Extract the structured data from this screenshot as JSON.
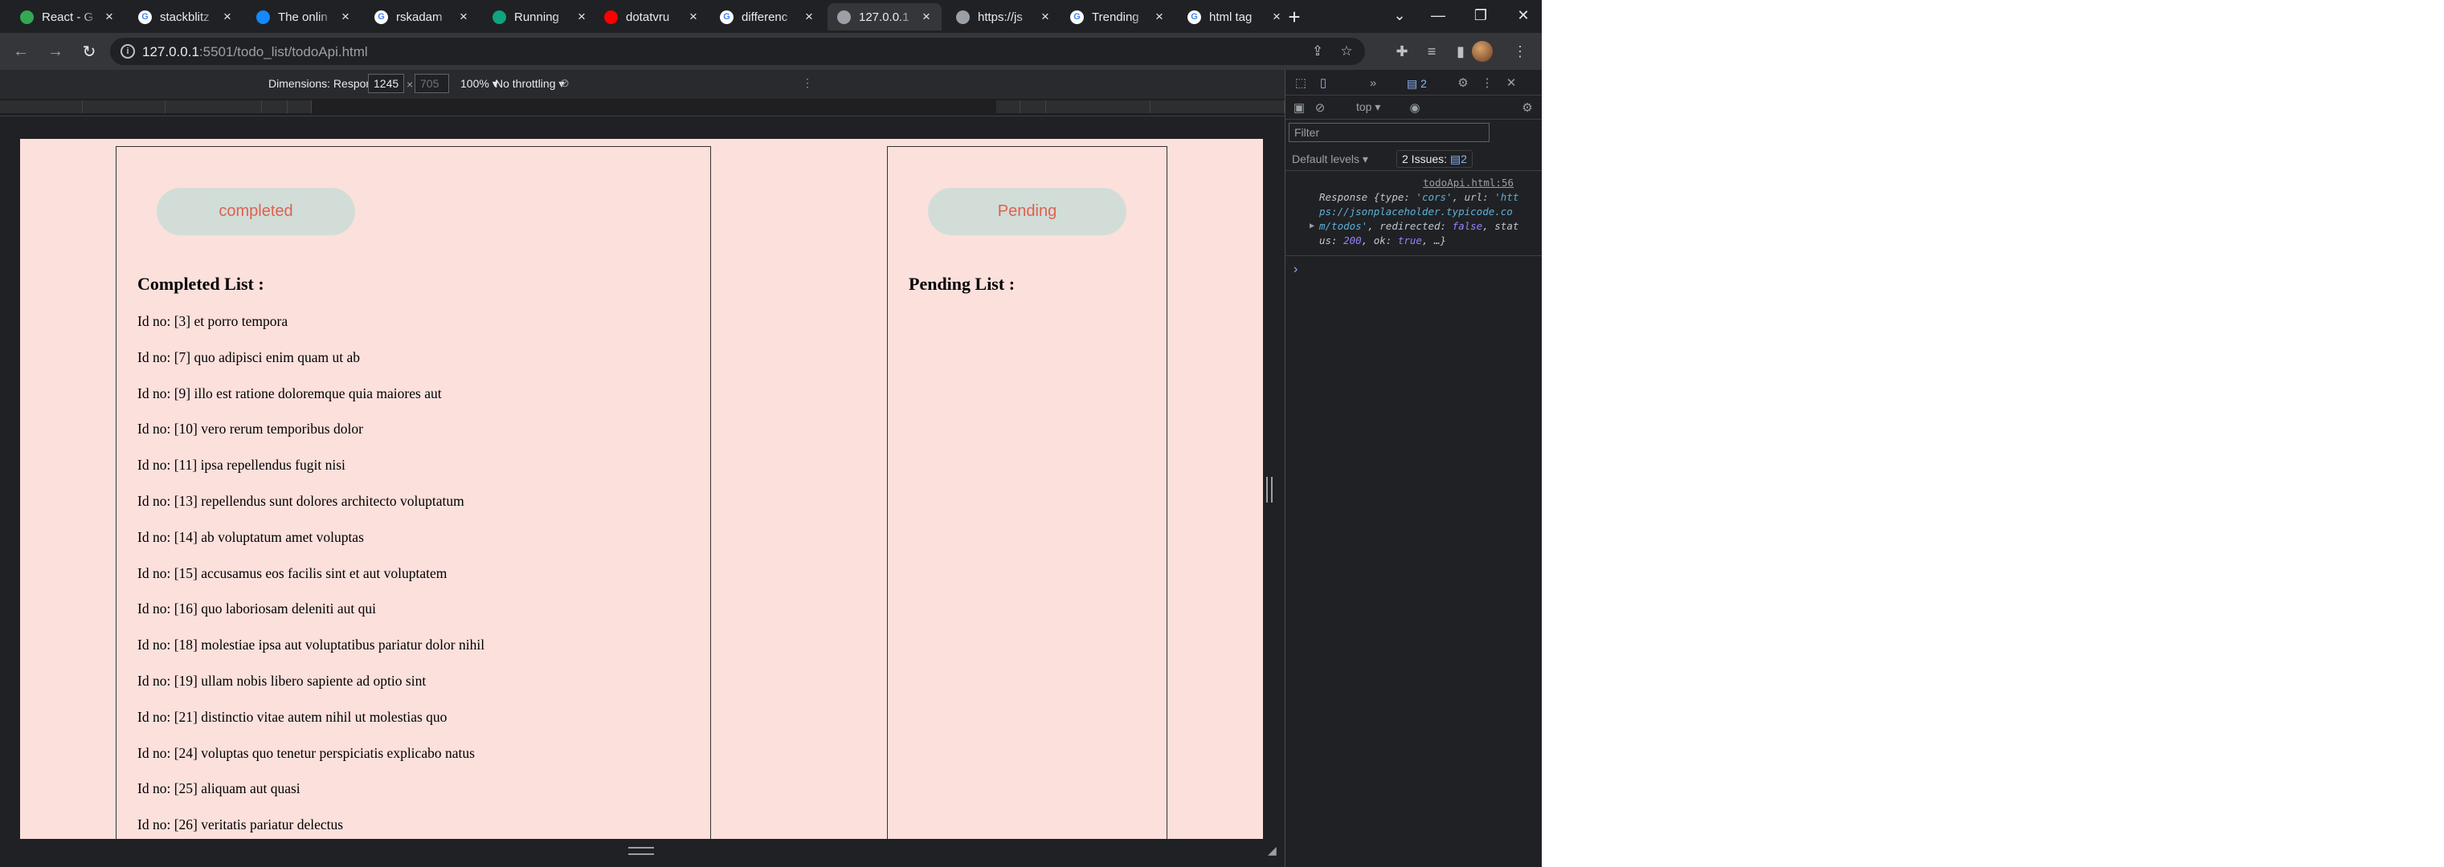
{
  "tabs": [
    {
      "label": "React - G",
      "icon": "google-drive-icon",
      "color": "#34a853",
      "left": 0
    },
    {
      "label": "stackblitz",
      "icon": "google-icon",
      "color": "#ffffff"
    },
    {
      "label": "The onlin",
      "icon": "stackblitz-icon",
      "color": "#1389fd"
    },
    {
      "label": "rskadam",
      "icon": "github-icon",
      "color": "#ffffff"
    },
    {
      "label": "Running",
      "icon": "openai-icon",
      "color": "#10a37f"
    },
    {
      "label": "dotatvru",
      "icon": "youtube-icon",
      "color": "#ff0000"
    },
    {
      "label": "differenc",
      "icon": "google-icon",
      "color": "#ffffff"
    },
    {
      "label": "127.0.0.1",
      "icon": "globe-icon",
      "color": "#9aa0a6",
      "active": true
    },
    {
      "label": "https://js",
      "icon": "jsonplaceholder-icon",
      "color": "#9aa0a6"
    },
    {
      "label": "Trending",
      "icon": "google-icon",
      "color": "#ffffff"
    },
    {
      "label": "html tag",
      "icon": "google-icon",
      "color": "#ffffff"
    }
  ],
  "address_bar": {
    "host": "127.0.0.1",
    "path": ":5501/todo_list/todoApi.html"
  },
  "device_toolbar": {
    "dimensions_label": "Dimensions: Responsive",
    "width": "1245",
    "x_sign": "×",
    "height": "705",
    "zoom": "100%",
    "throttling": "No throttling"
  },
  "page": {
    "completed_button": "completed",
    "pending_button": "Pending",
    "completed_title": "Completed List :",
    "pending_title": "Pending List :",
    "completed_items": [
      "Id no: [3] et porro tempora",
      "Id no: [7] quo adipisci enim quam ut ab",
      "Id no: [9] illo est ratione doloremque quia maiores aut",
      "Id no: [10] vero rerum temporibus dolor",
      "Id no: [11] ipsa repellendus fugit nisi",
      "Id no: [13] repellendus sunt dolores architecto voluptatum",
      "Id no: [14] ab voluptatum amet voluptas",
      "Id no: [15] accusamus eos facilis sint et aut voluptatem",
      "Id no: [16] quo laboriosam deleniti aut qui",
      "Id no: [18] molestiae ipsa aut voluptatibus pariatur dolor nihil",
      "Id no: [19] ullam nobis libero sapiente ad optio sint",
      "Id no: [21] distinctio vitae autem nihil ut molestias quo",
      "Id no: [24] voluptas quo tenetur perspiciatis explicabo natus",
      "Id no: [25] aliquam aut quasi",
      "Id no: [26] veritatis pariatur delectus"
    ]
  },
  "devtools": {
    "issues_count": "2",
    "context": "top",
    "filter_placeholder": "Filter",
    "levels": "Default levels",
    "issues_label": "2 Issues:",
    "issues_badge": "2",
    "message_source": "todoApi.html:56"
  }
}
